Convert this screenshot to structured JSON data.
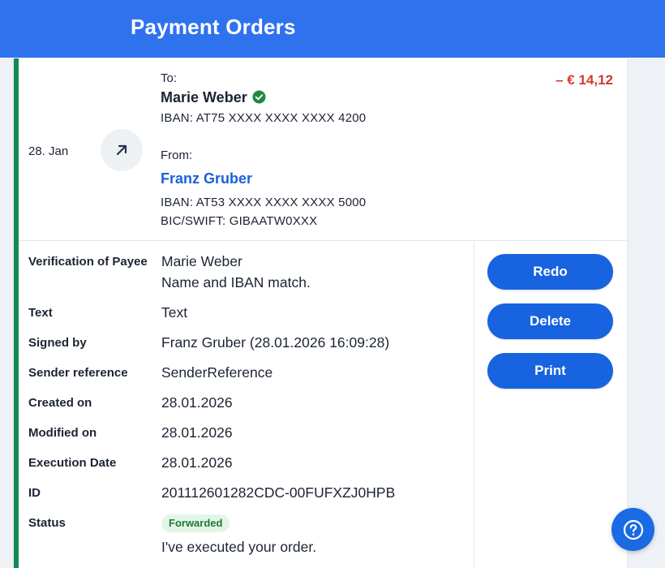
{
  "header": {
    "title": "Payment Orders"
  },
  "order": {
    "date": "28. Jan",
    "direction_icon": "arrow-up-right-icon",
    "amount": "– € 14,12",
    "amount_color": "#d23a2c",
    "to": {
      "label": "To:",
      "name": "Marie Weber",
      "verified_icon": "verified-check-icon",
      "iban": "IBAN: AT75 XXXX XXXX XXXX 4200"
    },
    "from": {
      "label": "From:",
      "name": "Franz Gruber",
      "iban": "IBAN: AT53 XXXX XXXX XXXX 5000",
      "bic": "BIC/SWIFT: GIBAATW0XXX"
    }
  },
  "details": {
    "verification": {
      "label": "Verification of Payee",
      "name": "Marie Weber",
      "result": "Name and IBAN match."
    },
    "text": {
      "label": "Text",
      "value": "Text"
    },
    "signed_by": {
      "label": "Signed by",
      "value": "Franz Gruber (28.01.2026 16:09:28)"
    },
    "sender_reference": {
      "label": "Sender reference",
      "value": "SenderReference"
    },
    "created_on": {
      "label": "Created on",
      "value": "28.01.2026"
    },
    "modified_on": {
      "label": "Modified on",
      "value": "28.01.2026"
    },
    "execution_date": {
      "label": "Execution Date",
      "value": "28.01.2026"
    },
    "id": {
      "label": "ID",
      "value": "201112601282CDC-00FUFXZJ0HPB"
    },
    "status": {
      "label": "Status",
      "badge": "Forwarded",
      "message": "I've executed your order."
    }
  },
  "actions": {
    "redo": "Redo",
    "delete": "Delete",
    "print": "Print"
  },
  "help_icon": "help-circle-icon",
  "colors": {
    "header": "#2f72ee",
    "accent_border": "#118a55",
    "button": "#1763e0",
    "badge_bg": "#e3f5e6",
    "badge_text": "#1e7a36"
  }
}
